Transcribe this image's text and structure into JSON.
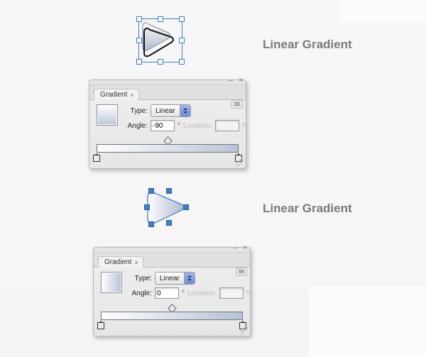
{
  "captions": {
    "one": "Linear Gradient",
    "two": "Linear Gradient"
  },
  "panel1": {
    "tab_label": "Gradient",
    "type_label": "Type:",
    "type_value": "Linear",
    "angle_label": "Angle:",
    "angle_value": "-90",
    "location_label": "Location:",
    "location_value": "",
    "pct": "%",
    "degree_symbol": "°",
    "window": {
      "minimize_glyph": "–",
      "close_glyph": "×"
    },
    "tab_close_glyph": "×"
  },
  "panel2": {
    "tab_label": "Gradient",
    "type_label": "Type:",
    "type_value": "Linear",
    "angle_label": "Angle:",
    "angle_value": "0",
    "location_label": "Location:",
    "location_value": "",
    "pct": "%",
    "degree_symbol": "°",
    "window": {
      "minimize_glyph": "–",
      "close_glyph": "×"
    },
    "tab_close_glyph": "×"
  }
}
